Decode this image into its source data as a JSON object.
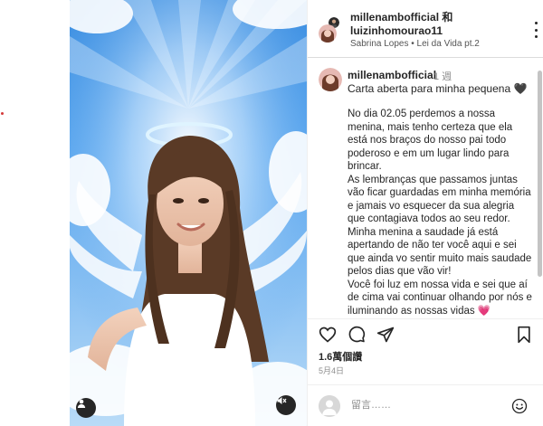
{
  "header": {
    "usernames": "millenambofficial 和 luizinhomourao11",
    "audio": "Sabrina Lopes • Lei da Vida pt.2"
  },
  "caption": {
    "username": "millenambofficial",
    "time": "1 週",
    "title": "Carta aberta para minha pequena 🖤",
    "paragraphs": [
      "No dia 02.05 perdemos a nossa menina, mais tenho certeza que ela está nos braços do nosso pai todo poderoso e em um lugar lindo para brincar.",
      "As lembranças que passamos juntas vão ficar guardadas em minha memória e jamais vo esquecer da sua alegria que contagiava todos ao seu redor. Minha menina a saudade já está apertando de não ter você aqui e sei que ainda vo sentir muito mais saudade pelos dias que vão vir!",
      "Você foi luz em nossa vida e sei que aí de cima vai continuar olhando por nós e iluminando as nossas vidas 💗"
    ]
  },
  "stats": {
    "likes": "1.6萬個讚",
    "date": "5月4日"
  },
  "comment": {
    "placeholder": "留言……"
  },
  "icons": {
    "like": "heart-icon",
    "comment": "comment-icon",
    "share": "share-icon",
    "save": "bookmark-icon",
    "emoji": "emoji-icon",
    "more": "more-options-icon",
    "mute": "muted-speaker-icon",
    "user_tag": "user-tag-icon"
  },
  "colors": {
    "sky_top": "#3b8de0",
    "sky_bottom": "#b9dbf7",
    "halo": "#dff4ff",
    "dress": "#ffffff",
    "hair": "#5a3a26"
  }
}
